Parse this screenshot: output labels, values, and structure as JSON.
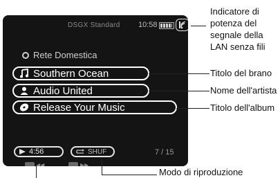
{
  "status": {
    "title": "DSGX Standard",
    "time": "10:58",
    "battery_icon": "battery-icon",
    "wifi_icon": "wifi-signal-icon"
  },
  "network": {
    "icon": "circle-icon",
    "label": "Rete Domestica"
  },
  "track": {
    "title": "Southern Ocean",
    "artist": "Audio United",
    "album": "Release Your Music",
    "title_icon": "music-note-icon",
    "artist_icon": "person-icon",
    "album_icon": "disc-icon"
  },
  "playback": {
    "time": "4:56",
    "mode": "SHUF",
    "counter": "7 / 15",
    "play_icon": "play-icon",
    "mode_icon": "shuffle-icon"
  },
  "callouts": {
    "wifi": "Indicatore di potenza del segnale della LAN senza fili",
    "title": "Titolo del brano",
    "artist": "Nome dell'artista",
    "album": "Titolo dell'album",
    "mode": "Modo di riproduzione"
  },
  "colors": {
    "screen_bg": "#141414",
    "text": "#ffffff"
  }
}
